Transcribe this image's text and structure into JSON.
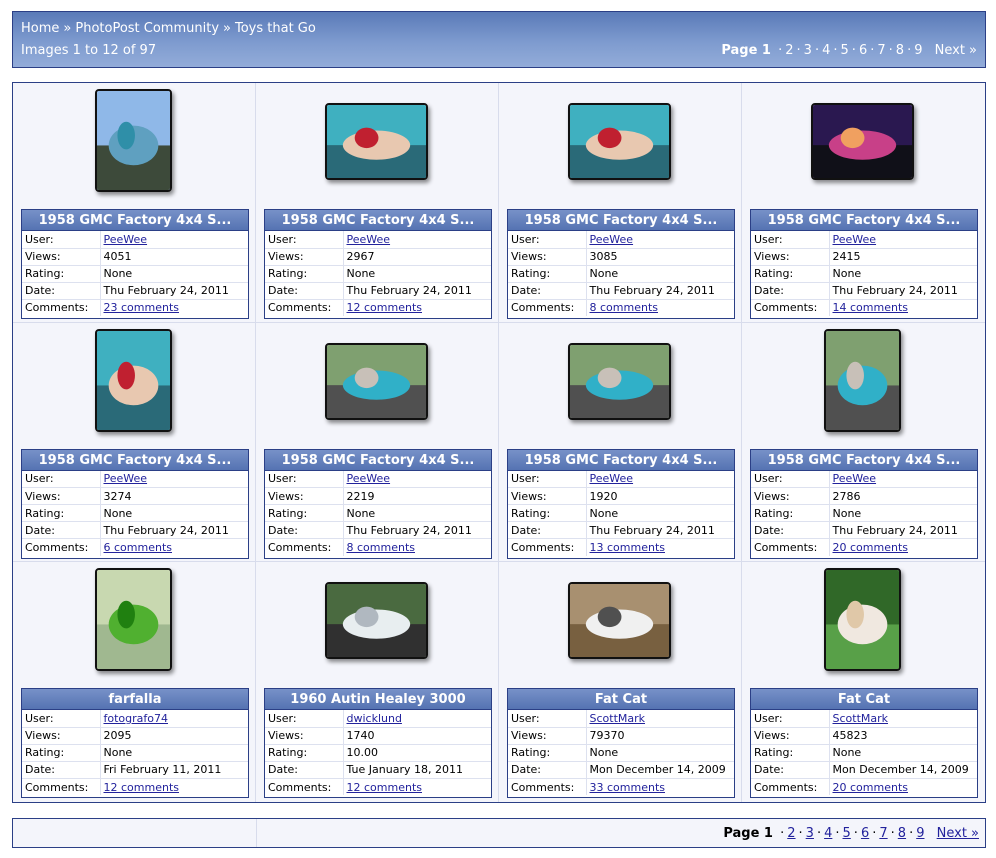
{
  "breadcrumb": [
    "Home",
    "PhotoPost Community",
    "Toys that Go"
  ],
  "image_count": "Images 1 to 12 of 97",
  "pagination": {
    "current_label": "Page 1",
    "pages": [
      "2",
      "3",
      "4",
      "5",
      "6",
      "7",
      "8",
      "9"
    ],
    "next": "Next »"
  },
  "labels": {
    "user": "User:",
    "views": "Views:",
    "rating": "Rating:",
    "date": "Date:",
    "comments": "Comments:"
  },
  "images": [
    {
      "title": "1958 GMC Factory 4x4 S...",
      "user": "PeeWee",
      "views": "4051",
      "rating": "None",
      "date": "Thu February 24, 2011",
      "comments": "23 comments",
      "orientation": "portrait",
      "palette": "truck-blue-sky"
    },
    {
      "title": "1958 GMC Factory 4x4 S...",
      "user": "PeeWee",
      "views": "2967",
      "rating": "None",
      "date": "Thu February 24, 2011",
      "comments": "12 comments",
      "orientation": "landscape",
      "palette": "pinup-teal"
    },
    {
      "title": "1958 GMC Factory 4x4 S...",
      "user": "PeeWee",
      "views": "3085",
      "rating": "None",
      "date": "Thu February 24, 2011",
      "comments": "8 comments",
      "orientation": "landscape",
      "palette": "pinup-teal"
    },
    {
      "title": "1958 GMC Factory 4x4 S...",
      "user": "PeeWee",
      "views": "2415",
      "rating": "None",
      "date": "Thu February 24, 2011",
      "comments": "14 comments",
      "orientation": "landscape",
      "palette": "sunset"
    },
    {
      "title": "1958 GMC Factory 4x4 S...",
      "user": "PeeWee",
      "views": "3274",
      "rating": "None",
      "date": "Thu February 24, 2011",
      "comments": "6 comments",
      "orientation": "portrait",
      "palette": "pinup-teal"
    },
    {
      "title": "1958 GMC Factory 4x4 S...",
      "user": "PeeWee",
      "views": "2219",
      "rating": "None",
      "date": "Thu February 24, 2011",
      "comments": "8 comments",
      "orientation": "landscape",
      "palette": "truck-street"
    },
    {
      "title": "1958 GMC Factory 4x4 S...",
      "user": "PeeWee",
      "views": "1920",
      "rating": "None",
      "date": "Thu February 24, 2011",
      "comments": "13 comments",
      "orientation": "landscape",
      "palette": "truck-street"
    },
    {
      "title": "1958 GMC Factory 4x4 S...",
      "user": "PeeWee",
      "views": "2786",
      "rating": "None",
      "date": "Thu February 24, 2011",
      "comments": "20 comments",
      "orientation": "portrait",
      "palette": "truck-street"
    },
    {
      "title": "farfalla",
      "user": "fotografo74",
      "views": "2095",
      "rating": "None",
      "date": "Fri February 11, 2011",
      "comments": "12 comments",
      "orientation": "portrait",
      "palette": "caterpillar"
    },
    {
      "title": "1960 Autin Healey 3000",
      "user": "dwicklund",
      "views": "1740",
      "rating": "10.00",
      "date": "Tue January 18, 2011",
      "comments": "12 comments",
      "orientation": "landscape",
      "palette": "white-car"
    },
    {
      "title": "Fat Cat",
      "user": "ScottMark",
      "views": "79370",
      "rating": "None",
      "date": "Mon December 14, 2009",
      "comments": "33 comments",
      "orientation": "landscape",
      "palette": "fat-cat"
    },
    {
      "title": "Fat Cat",
      "user": "ScottMark",
      "views": "45823",
      "rating": "None",
      "date": "Mon December 14, 2009",
      "comments": "20 comments",
      "orientation": "portrait",
      "palette": "white-cat"
    }
  ],
  "palettes": {
    "truck-blue-sky": [
      "#8fb8e8",
      "#5fa0c0",
      "#2f8fa8",
      "#3d4a3a"
    ],
    "pinup-teal": [
      "#3fb0c0",
      "#e8c8b0",
      "#c02030",
      "#2a6a78"
    ],
    "sunset": [
      "#2a1850",
      "#c84088",
      "#f0a060",
      "#101018"
    ],
    "truck-street": [
      "#7fa070",
      "#30b0c8",
      "#c8c0b8",
      "#505050"
    ],
    "caterpillar": [
      "#c8d8b0",
      "#50b030",
      "#208010",
      "#a0b890"
    ],
    "white-car": [
      "#4a6a40",
      "#e8eef0",
      "#b0b8c0",
      "#303030"
    ],
    "fat-cat": [
      "#a89070",
      "#f0f0f0",
      "#505050",
      "#786040"
    ],
    "white-cat": [
      "#306828",
      "#f0e8e0",
      "#e0c8a8",
      "#58a048"
    ]
  }
}
